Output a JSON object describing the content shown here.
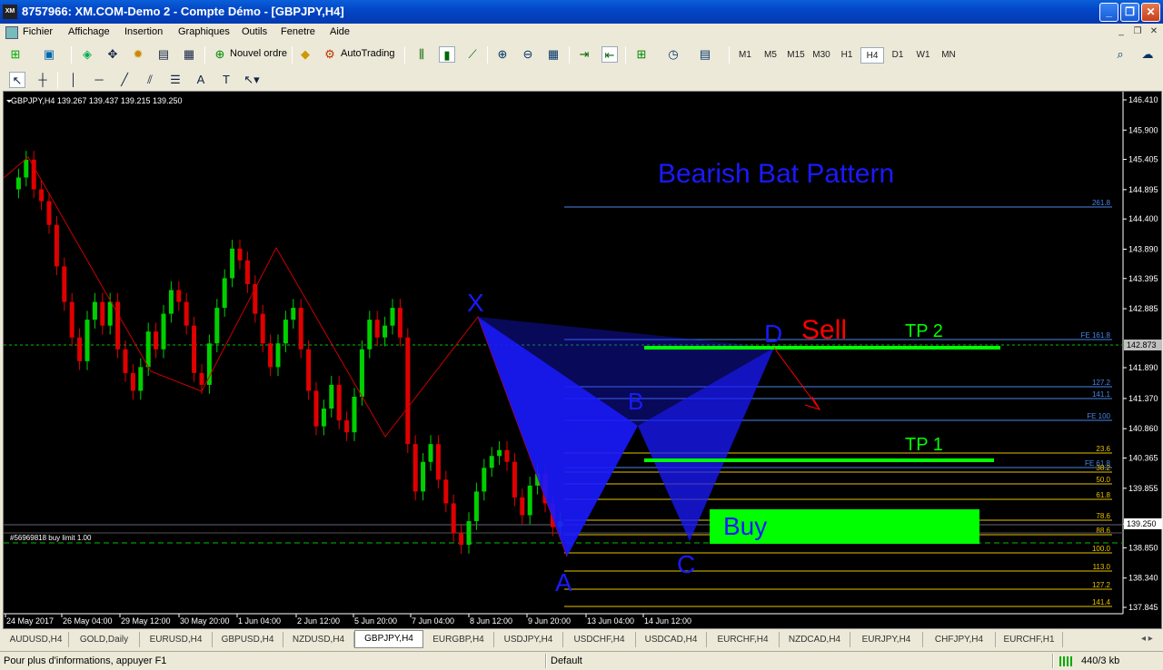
{
  "window": {
    "title": "8757966: XM.COM-Demo 2 - Compte Démo - [GBPJPY,H4]",
    "app_icon_text": "XM",
    "min": "0",
    "max": "1",
    "close": "r"
  },
  "menu": [
    "Fichier",
    "Affichage",
    "Insertion",
    "Graphiques",
    "Outils",
    "Fenetre",
    "Aide"
  ],
  "toolbar": {
    "new_order": "Nouvel ordre",
    "autotrading": "AutoTrading",
    "timeframes": [
      "M1",
      "M5",
      "M15",
      "M30",
      "H1",
      "H4",
      "D1",
      "W1",
      "MN"
    ],
    "active_timeframe": "H4",
    "draw_tools": [
      "A",
      "T"
    ]
  },
  "chart": {
    "symbol_info": "GBPJPY,H4  139.267 139.437 139.215 139.250",
    "pattern_title": "Bearish Bat Pattern",
    "point_labels": {
      "X": "X",
      "A": "A",
      "B": "B",
      "C": "C",
      "D": "D"
    },
    "sell_label": "Sell",
    "buy_label": "Buy",
    "tp1_label": "TP 1",
    "tp2_label": "TP 2",
    "order_label": "#56969818 buy limit 1.00",
    "price_ticks": [
      "146.410",
      "145.900",
      "145.405",
      "144.895",
      "144.400",
      "143.890",
      "143.395",
      "142.885",
      "141.890",
      "141.370",
      "140.860",
      "140.365",
      "139.855",
      "139.250",
      "138.850",
      "138.340",
      "137.845"
    ],
    "current_price": "139.250",
    "d_price_badge": "142.873",
    "time_ticks": [
      "24 May 2017",
      "26 May 04:00",
      "29 May 12:00",
      "30 May 20:00",
      "1 Jun 04:00",
      "2 Jun 12:00",
      "5 Jun 20:00",
      "7 Jun 04:00",
      "8 Jun 12:00",
      "9 Jun 20:00",
      "13 Jun 04:00",
      "14 Jun 12:00"
    ],
    "fib_levels": [
      {
        "label": "261.8",
        "color": "#4a86e8"
      },
      {
        "label": "FE 161.8",
        "color": "#4a86e8"
      },
      {
        "label": "127.2",
        "color": "#4a86e8"
      },
      {
        "label": "141.1",
        "color": "#4a86e8"
      },
      {
        "label": "FE 100",
        "color": "#4a86e8"
      },
      {
        "label": "23.6",
        "color": "#e6c200"
      },
      {
        "label": "FE 61.8",
        "color": "#4a86e8"
      },
      {
        "label": "38.2",
        "color": "#e6c200"
      },
      {
        "label": "50.0",
        "color": "#e6c200"
      },
      {
        "label": "61.8",
        "color": "#e6c200"
      },
      {
        "label": "78.6",
        "color": "#e6c200"
      },
      {
        "label": "88.6",
        "color": "#e6c200"
      },
      {
        "label": "100.0",
        "color": "#e6c200"
      },
      {
        "label": "113.0",
        "color": "#e6c200"
      },
      {
        "label": "127.2",
        "color": "#e6c200"
      },
      {
        "label": "141.4",
        "color": "#e6c200"
      }
    ],
    "colors": {
      "bull": "#00d000",
      "bear": "#e00000",
      "pattern": "#1a1aff",
      "sell": "#ff0000",
      "tp": "#00ff00",
      "zigzag": "#cc0000"
    }
  },
  "tabs": [
    "AUDUSD,H4",
    "GOLD,Daily",
    "EURUSD,H4",
    "GBPUSD,H4",
    "NZDUSD,H4",
    "GBPJPY,H4",
    "EURGBP,H4",
    "USDJPY,H4",
    "USDCHF,H4",
    "USDCAD,H4",
    "EURCHF,H4",
    "NZDCAD,H4",
    "EURJPY,H4",
    "CHFJPY,H4",
    "EURCHF,H1"
  ],
  "active_tab": "GBPJPY,H4",
  "status": {
    "help": "Pour plus d'informations, appuyer F1",
    "profile": "Default",
    "traffic": "440/3 kb"
  }
}
